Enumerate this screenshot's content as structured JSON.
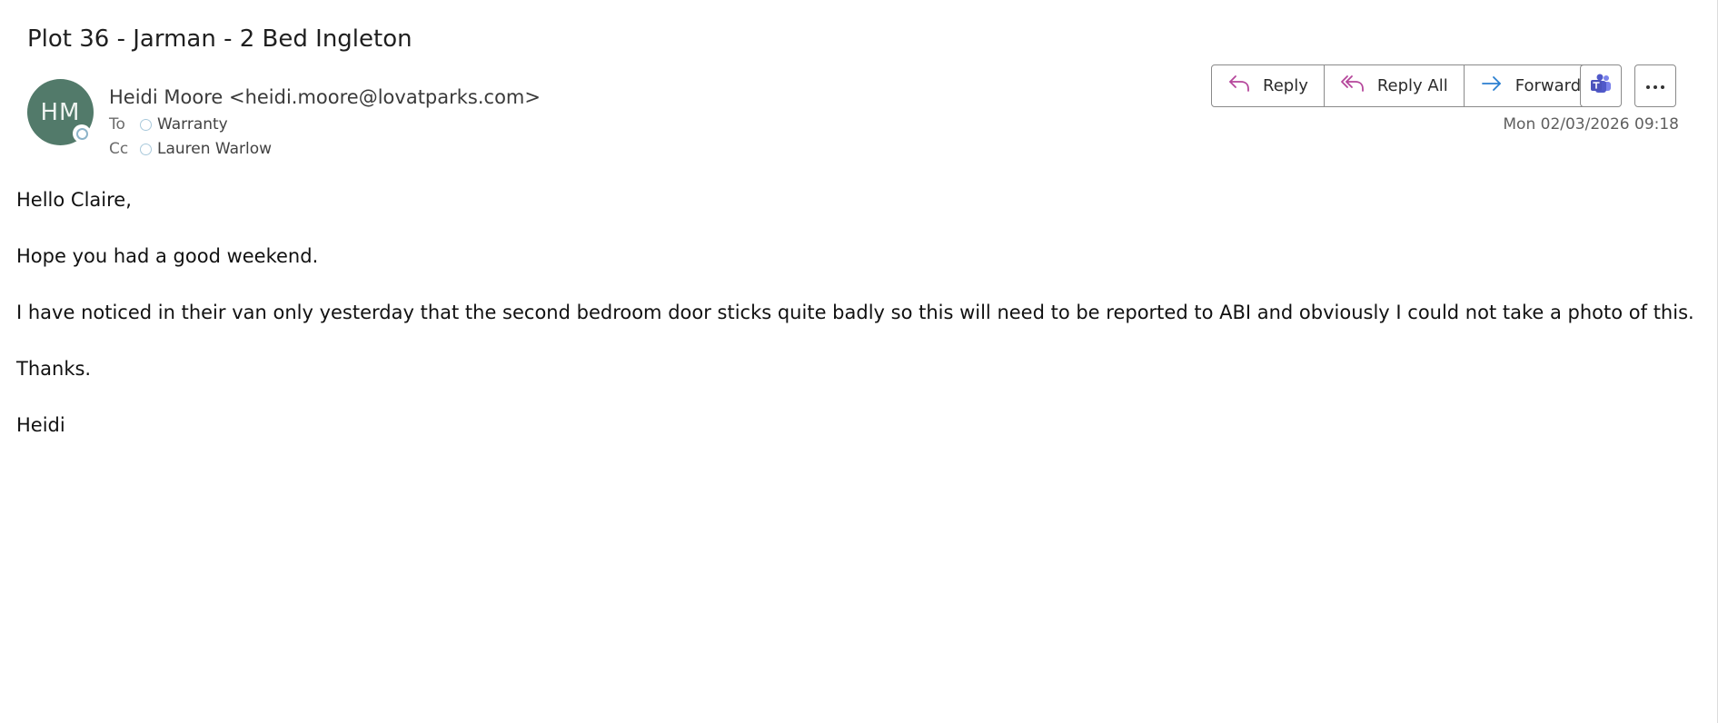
{
  "email": {
    "subject": "Plot 36 - Jarman - 2 Bed Ingleton",
    "avatar_initials": "HM",
    "sender": "Heidi Moore <heidi.moore@lovatparks.com>",
    "to_label": "To",
    "to": "Warranty",
    "cc_label": "Cc",
    "cc": "Lauren Warlow",
    "timestamp": "Mon 02/03/2026 09:18"
  },
  "actions": {
    "reply": "Reply",
    "reply_all": "Reply All",
    "forward": "Forward",
    "teams_icon": "teams-icon",
    "more_icon": "more-icon"
  },
  "body": {
    "p1": "Hello Claire,",
    "p2": "Hope you had a good weekend.",
    "p3": "I have noticed in their van only yesterday that the second bedroom door sticks quite badly so this will need to be reported to ABI and obviously I could not take a photo of this.",
    "p4": "Thanks.",
    "p5": "Heidi"
  },
  "colors": {
    "avatar_bg": "#527a6a",
    "reply_icon": "#b5469b",
    "forward_icon": "#2a7fd0",
    "teams": "#5059c9"
  }
}
